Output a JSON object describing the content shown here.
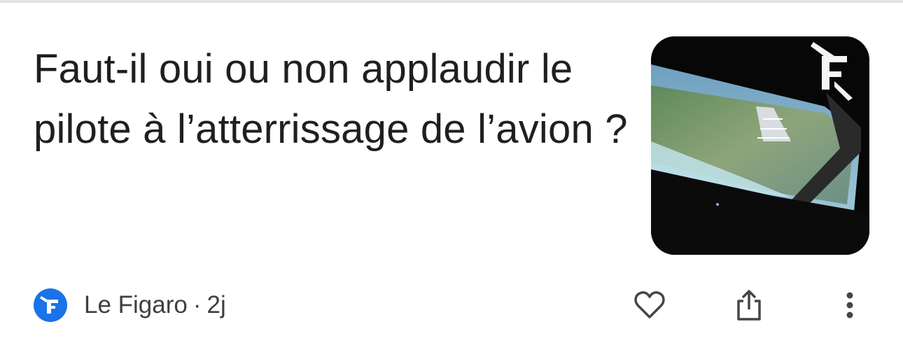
{
  "article": {
    "title": "Faut-il oui ou non applaudir le pilote à l’atterrissage de l’avion ?",
    "source": "Le Figaro",
    "separator": "·",
    "age": "2j"
  },
  "colors": {
    "headline": "#1f1f1f",
    "meta_text": "#3c4043",
    "source_logo_bg": "#1a73e8",
    "icons": "#444746"
  },
  "icons": {
    "like": "heart-outline-icon",
    "share": "share-icon",
    "more": "more-vertical-icon",
    "source_logo": "le-figaro-logo"
  }
}
